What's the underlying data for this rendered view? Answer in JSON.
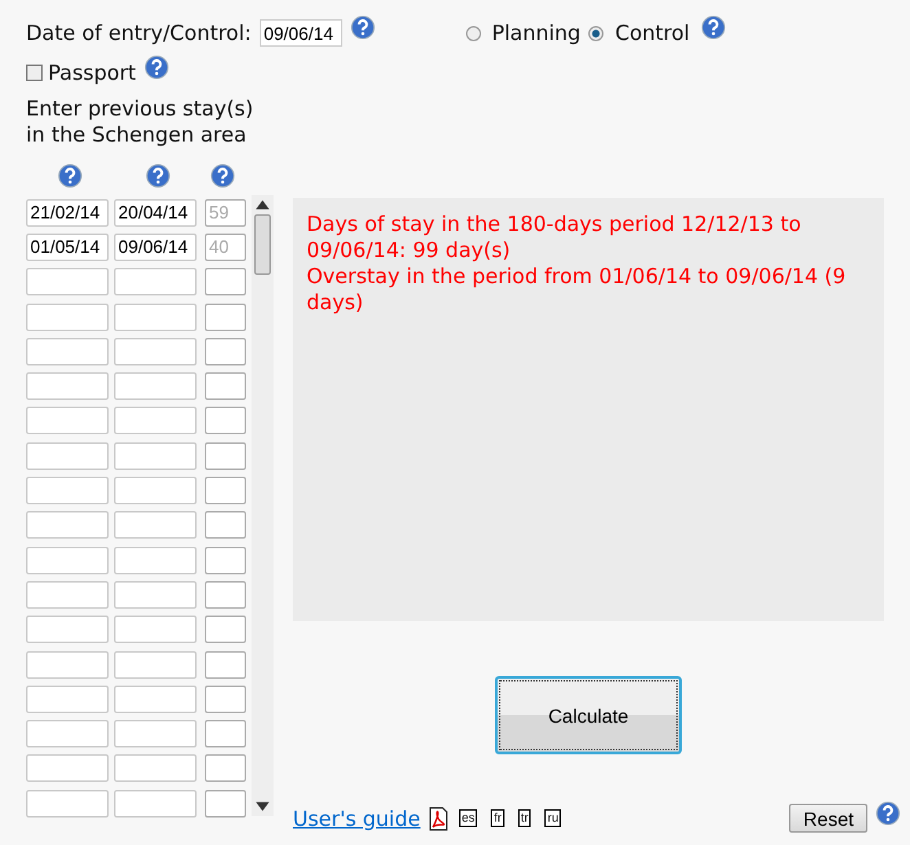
{
  "entry": {
    "label": "Date of entry/Control:",
    "value": "09/06/14"
  },
  "modes": [
    {
      "label": "Planning",
      "selected": false
    },
    {
      "label": "Control",
      "selected": true
    }
  ],
  "passport": {
    "label": "Passport",
    "checked": false
  },
  "instructions": "Enter previous stay(s) in the Schengen area",
  "stays": [
    {
      "kind": "filled",
      "from": "21/02/14",
      "to": "20/04/14",
      "days": "59"
    },
    {
      "kind": "filled",
      "from": "01/05/14",
      "to": "09/06/14",
      "days": "40"
    },
    {
      "kind": "blank"
    },
    {
      "kind": "blank"
    },
    {
      "kind": "blank"
    },
    {
      "kind": "blank"
    },
    {
      "kind": "blank"
    },
    {
      "kind": "blank"
    },
    {
      "kind": "blank"
    },
    {
      "kind": "blank"
    },
    {
      "kind": "blank"
    },
    {
      "kind": "blank"
    },
    {
      "kind": "blank"
    },
    {
      "kind": "blank"
    },
    {
      "kind": "blank"
    },
    {
      "kind": "blank"
    },
    {
      "kind": "blank"
    },
    {
      "kind": "blank"
    }
  ],
  "result": [
    "Days of stay in the 180-days period 12/12/13 to 09/06/14: 99 day(s)",
    "Overstay in the period from 01/06/14 to 09/06/14 (9 days)"
  ],
  "calculate": "Calculate",
  "guide": {
    "label": "User's guide",
    "languages": [
      "es",
      "fr",
      "tr",
      "ru"
    ]
  },
  "reset": "Reset"
}
